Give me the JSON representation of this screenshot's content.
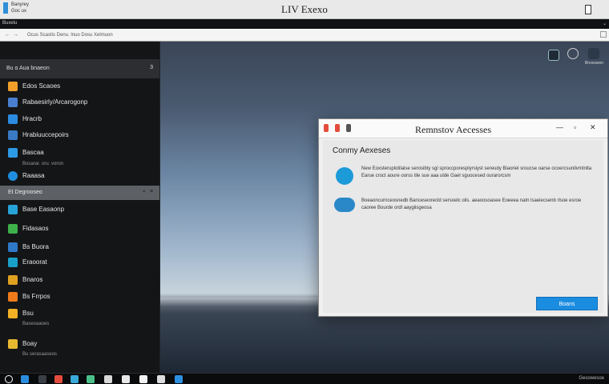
{
  "window": {
    "title": "LIV Exexo",
    "app_label_1": "Banyrey",
    "app_label_2": "Goc ux"
  },
  "menubar": {
    "left": "Buxelu",
    "right": "⌄"
  },
  "addressbar": {
    "text": "Ocus  Scastis  Denu. lnuo  Dosu  Xelmuon"
  },
  "sidebar": {
    "header": {
      "label": "Bu  ɑ  Aua  bnaeon",
      "count": "3"
    },
    "items": [
      {
        "label": "Edos Scaoes",
        "color": "#f0a02a"
      },
      {
        "label": "Rabaesirly/Arcarogonp",
        "color": "#4a7fd0"
      },
      {
        "label": "Hracrb",
        "color": "#2b8be0"
      },
      {
        "label": "Hrabiuuccepoirs",
        "color": "#3a79c4"
      },
      {
        "label": "Bascaa",
        "color": "#2d9ae6",
        "sub": "Bosarar. oru. voron"
      },
      {
        "label": "Raaasa",
        "color": "#1f8ee0"
      }
    ],
    "selected": {
      "label": "Et  Degrooseo"
    },
    "items2": [
      {
        "label": "Base Easaonp",
        "color": "#26a2d6"
      },
      {
        "label": "Fidasaos",
        "color": "#3db04a"
      },
      {
        "label": "Bs Buora",
        "color": "#2f78c8"
      },
      {
        "label": "Eraoorat",
        "color": "#19a0c8"
      },
      {
        "label": "Bnaros",
        "color": "#e0a020"
      },
      {
        "label": "Bs Frrpos",
        "color": "#f07a1a"
      },
      {
        "label": "Bsu",
        "color": "#f2b024",
        "sub": "Baseoaaoes"
      },
      {
        "label": "Boay",
        "color": "#e8b830",
        "sub": "Bu serasaaseos"
      }
    ]
  },
  "desktop": {
    "icons": [
      "Brvooaren"
    ]
  },
  "dialog": {
    "title": "Remnstov Aecesses",
    "heading": "Conmy Aexeses",
    "rows": [
      {
        "text": "New Eoxsteruplotilaise serosibty sgl sproccporesplyrsiyst sereudy Biaoriel sroucse oarse ocoercsunilvmtnlta Earue croct aoure oorss tile sue aaa ulde Gael sguocesed ourarorcsm",
        "color": "#1d9bd8"
      },
      {
        "text": "Boeaoncurnceosnedb Banceseorecld sersoelc olis. aeaoosoasee Eoeeea natn lsaeiecsenb rlsoe esroe caoree Bourde ordl aaygiisgeosa",
        "color": "#2a88c8"
      }
    ],
    "primary_button": "Boans"
  },
  "taskbar": {
    "tray_text": "Gesowesoe",
    "apps": [
      "#ffffff",
      "#2a8de0",
      "#e34c3c",
      "#3aa8d8",
      "#4abf88",
      "#e8e8e8",
      "#d8d8d8",
      "#f2f2f2",
      "#2d8fe0"
    ]
  }
}
